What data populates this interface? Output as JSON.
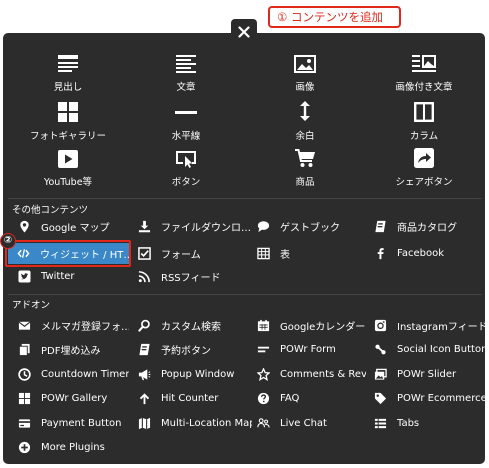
{
  "callout_add_content": "① コンテンツを追加",
  "callout_two": "②",
  "tiles": [
    {
      "label": "見出し",
      "icon": "heading-icon"
    },
    {
      "label": "文章",
      "icon": "text-icon"
    },
    {
      "label": "画像",
      "icon": "image-icon"
    },
    {
      "label": "画像付き文章",
      "icon": "image-text-icon"
    },
    {
      "label": "フォトギャラリー",
      "icon": "photo-gallery-icon"
    },
    {
      "label": "水平線",
      "icon": "horizontal-line-icon"
    },
    {
      "label": "余白",
      "icon": "spacing-icon"
    },
    {
      "label": "カラム",
      "icon": "columns-icon"
    },
    {
      "label": "YouTube等",
      "icon": "youtube-icon"
    },
    {
      "label": "ボタン",
      "icon": "button-icon"
    },
    {
      "label": "商品",
      "icon": "cart-icon"
    },
    {
      "label": "シェアボタン",
      "icon": "share-icon"
    }
  ],
  "other_section": {
    "label": "その他コンテンツ",
    "items": [
      {
        "label": "Google マップ",
        "icon": "map-pin-icon"
      },
      {
        "label": "ファイルダウンロ…",
        "icon": "download-icon"
      },
      {
        "label": "ゲストブック",
        "icon": "chat-bubble-icon"
      },
      {
        "label": "商品カタログ",
        "icon": "catalog-icon"
      },
      {
        "label": "ウィジェット / HT…",
        "icon": "code-icon"
      },
      {
        "label": "フォーム",
        "icon": "checkbox-form-icon"
      },
      {
        "label": "表",
        "icon": "table-icon"
      },
      {
        "label": "Facebook",
        "icon": "facebook-icon"
      },
      {
        "label": "Twitter",
        "icon": "twitter-icon"
      },
      {
        "label": "RSSフィード",
        "icon": "rss-icon"
      }
    ]
  },
  "addon_section": {
    "label": "アドオン",
    "items": [
      {
        "label": "メルマガ登録フォ…",
        "icon": "mail-icon"
      },
      {
        "label": "カスタム検索",
        "icon": "search-icon"
      },
      {
        "label": "Googleカレンダー",
        "icon": "calendar-icon"
      },
      {
        "label": "Instagramフィード",
        "icon": "instagram-icon"
      },
      {
        "label": "PDF埋め込み",
        "icon": "pdf-icon"
      },
      {
        "label": "予約ボタン",
        "icon": "booking-icon"
      },
      {
        "label": "POWr Form",
        "icon": "form-bars-icon"
      },
      {
        "label": "Social Icon Buttons",
        "icon": "social-link-icon"
      },
      {
        "label": "Countdown Timer",
        "icon": "clock-icon"
      },
      {
        "label": "Popup Window",
        "icon": "megaphone-icon"
      },
      {
        "label": "Comments & Revi…",
        "icon": "star-icon"
      },
      {
        "label": "POWr Slider",
        "icon": "slider-icon"
      },
      {
        "label": "POWr Gallery",
        "icon": "gallery-grid-icon"
      },
      {
        "label": "Hit Counter",
        "icon": "arrow-up-icon"
      },
      {
        "label": "FAQ",
        "icon": "question-icon"
      },
      {
        "label": "POWr Ecommerce",
        "icon": "tag-icon"
      },
      {
        "label": "Payment Button",
        "icon": "credit-card-icon"
      },
      {
        "label": "Multi-Location Map",
        "icon": "multi-map-icon"
      },
      {
        "label": "Live Chat",
        "icon": "live-chat-icon"
      },
      {
        "label": "Tabs",
        "icon": "tabs-icon"
      },
      {
        "label": "More Plugins",
        "icon": "plus-circle-icon"
      }
    ]
  },
  "colors": {
    "panel_bg": "#2c2c2c",
    "text": "#ffffff",
    "selected_bg": "#3b88c9",
    "highlight": "#e2271b"
  }
}
